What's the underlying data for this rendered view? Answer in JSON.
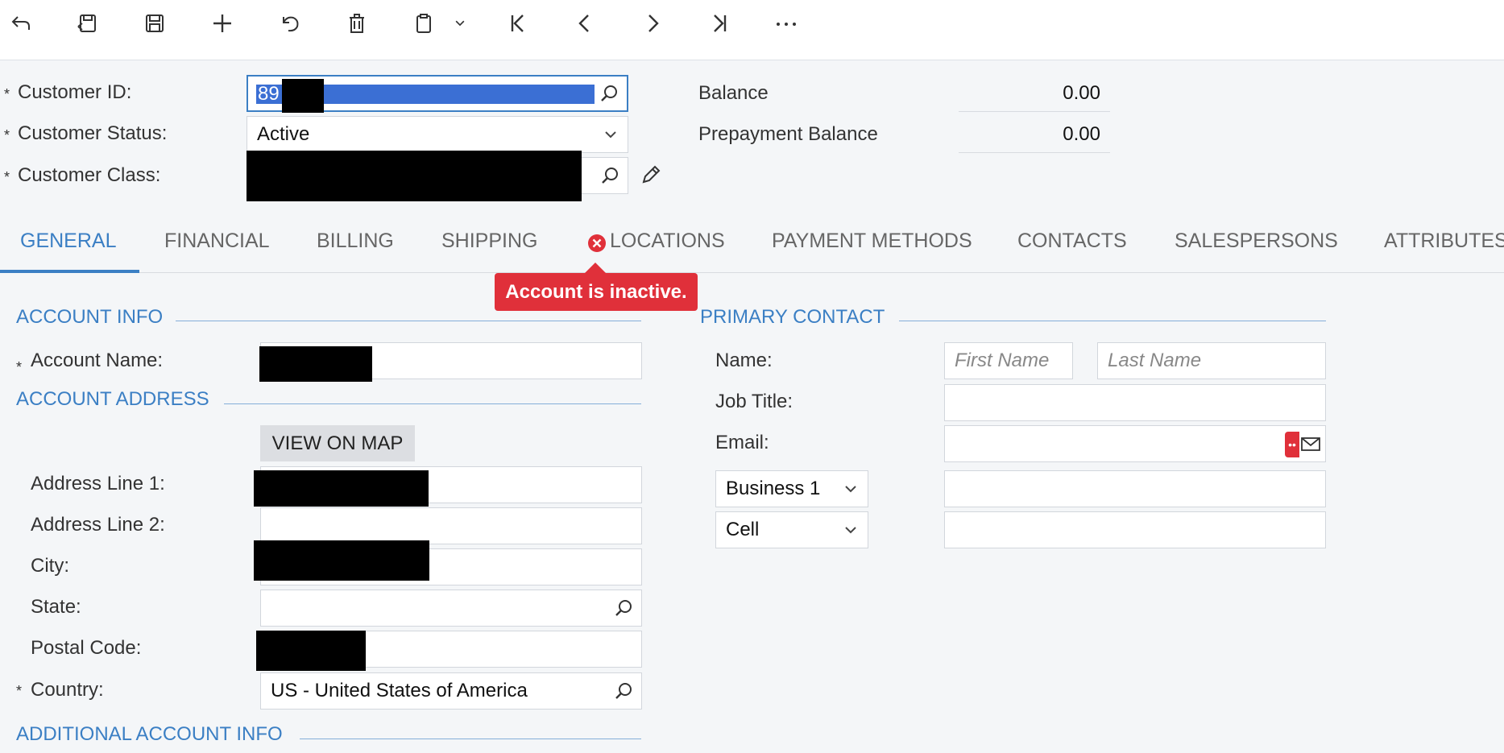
{
  "header": {
    "customer_id_label": "Customer ID:",
    "customer_id_value": "89",
    "customer_status_label": "Customer Status:",
    "customer_status_value": "Active",
    "customer_class_label": "Customer Class:",
    "balance_label": "Balance",
    "balance_value": "0.00",
    "prepayment_label": "Prepayment Balance",
    "prepayment_value": "0.00",
    "required_mark": "*"
  },
  "tabs": [
    {
      "label": "GENERAL"
    },
    {
      "label": "FINANCIAL"
    },
    {
      "label": "BILLING"
    },
    {
      "label": "SHIPPING"
    },
    {
      "label": "LOCATIONS"
    },
    {
      "label": "PAYMENT METHODS"
    },
    {
      "label": "CONTACTS"
    },
    {
      "label": "SALESPERSONS"
    },
    {
      "label": "ATTRIBUTES"
    }
  ],
  "tooltip": {
    "text": "Account is inactive."
  },
  "account_info": {
    "title": "ACCOUNT INFO",
    "account_name_label": "Account Name:"
  },
  "account_address": {
    "title": "ACCOUNT ADDRESS",
    "view_on_map": "VIEW ON MAP",
    "address1_label": "Address Line 1:",
    "address2_label": "Address Line 2:",
    "city_label": "City:",
    "state_label": "State:",
    "postal_label": "Postal Code:",
    "country_label": "Country:",
    "country_value": "US - United States of America"
  },
  "additional": {
    "title": "ADDITIONAL ACCOUNT INFO"
  },
  "primary_contact": {
    "title": "PRIMARY CONTACT",
    "name_label": "Name:",
    "first_name_placeholder": "First Name",
    "last_name_placeholder": "Last Name",
    "job_title_label": "Job Title:",
    "email_label": "Email:",
    "phone1_type": "Business 1",
    "phone2_type": "Cell"
  },
  "colors": {
    "accent": "#3b7fc4",
    "error": "#e0303a",
    "selection": "#3b6fd4"
  }
}
